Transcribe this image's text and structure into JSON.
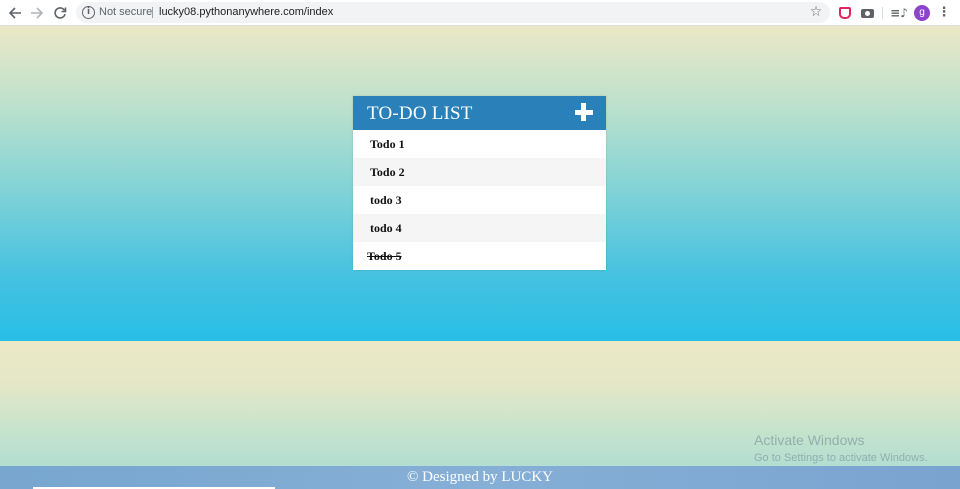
{
  "browser": {
    "security_label": "Not secure",
    "url": "lucky08.pythonanywhere.com/index",
    "avatar_letter": "g"
  },
  "todo": {
    "title": "TO-DO LIST",
    "items": [
      {
        "text": "Todo 1",
        "done": false
      },
      {
        "text": "Todo 2",
        "done": false
      },
      {
        "text": "todo 3",
        "done": false
      },
      {
        "text": "todo 4",
        "done": false
      },
      {
        "text": "Todo 5",
        "done": true
      }
    ]
  },
  "footer": {
    "text": "© Designed by LUCKY"
  },
  "watermark": {
    "title": "Activate Windows",
    "subtitle": "Go to Settings to activate Windows."
  },
  "colors": {
    "header": "#2a80b9",
    "footer": "#7aa6d2",
    "hero_top": "#ebe8c6",
    "hero_bottom": "#27bee6"
  },
  "icons": {
    "back": "arrow-left-icon",
    "forward": "arrow-right-icon",
    "reload": "reload-icon",
    "info": "info-icon",
    "star": "star-icon",
    "add": "plus-icon",
    "menu": "kebab-menu-icon"
  }
}
